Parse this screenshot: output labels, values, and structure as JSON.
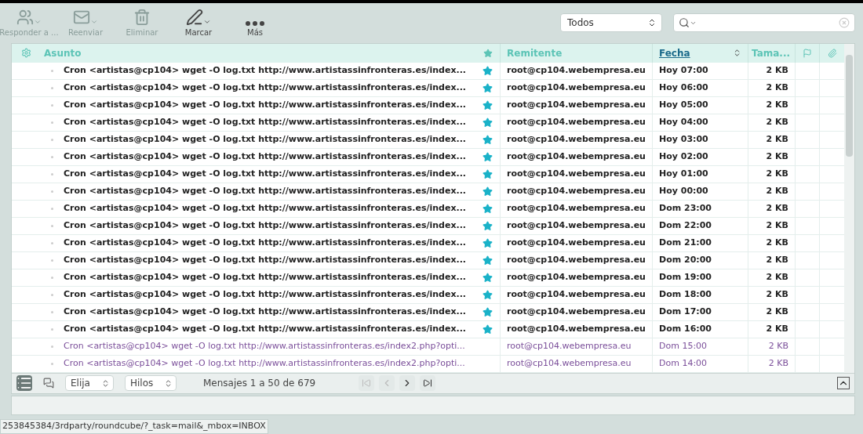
{
  "toolbar": {
    "buttons": [
      {
        "label": "Responder a ...",
        "kind": "reply",
        "disabled": true,
        "menu": true
      },
      {
        "label": "Reenviar",
        "kind": "forward",
        "disabled": true,
        "menu": true
      },
      {
        "label": "Eliminar",
        "kind": "delete",
        "disabled": true,
        "menu": false
      },
      {
        "label": "Marcar",
        "kind": "mark",
        "disabled": false,
        "menu": true
      },
      {
        "label": "Más",
        "kind": "more",
        "disabled": false,
        "menu": false
      }
    ],
    "filter": {
      "value": "Todos"
    }
  },
  "table": {
    "columns": [
      {
        "label": "Asunto",
        "sorted": false
      },
      {
        "label": "Remitente",
        "sorted": false
      },
      {
        "label": "Fecha",
        "sorted": true
      },
      {
        "label": "Tama..."
      }
    ],
    "rows": [
      {
        "subject": "Cron <artistas@cp104> wget -O log.txt http://www.artistassinfronteras.es/index...",
        "sender": "root@cp104.webempresa.eu",
        "date": "Hoy 07:00",
        "size": "2 KB",
        "unread": true,
        "starred": true
      },
      {
        "subject": "Cron <artistas@cp104> wget -O log.txt http://www.artistassinfronteras.es/index...",
        "sender": "root@cp104.webempresa.eu",
        "date": "Hoy 06:00",
        "size": "2 KB",
        "unread": true,
        "starred": true
      },
      {
        "subject": "Cron <artistas@cp104> wget -O log.txt http://www.artistassinfronteras.es/index...",
        "sender": "root@cp104.webempresa.eu",
        "date": "Hoy 05:00",
        "size": "2 KB",
        "unread": true,
        "starred": true
      },
      {
        "subject": "Cron <artistas@cp104> wget -O log.txt http://www.artistassinfronteras.es/index...",
        "sender": "root@cp104.webempresa.eu",
        "date": "Hoy 04:00",
        "size": "2 KB",
        "unread": true,
        "starred": true
      },
      {
        "subject": "Cron <artistas@cp104> wget -O log.txt http://www.artistassinfronteras.es/index...",
        "sender": "root@cp104.webempresa.eu",
        "date": "Hoy 03:00",
        "size": "2 KB",
        "unread": true,
        "starred": true
      },
      {
        "subject": "Cron <artistas@cp104> wget -O log.txt http://www.artistassinfronteras.es/index...",
        "sender": "root@cp104.webempresa.eu",
        "date": "Hoy 02:00",
        "size": "2 KB",
        "unread": true,
        "starred": true
      },
      {
        "subject": "Cron <artistas@cp104> wget -O log.txt http://www.artistassinfronteras.es/index...",
        "sender": "root@cp104.webempresa.eu",
        "date": "Hoy 01:00",
        "size": "2 KB",
        "unread": true,
        "starred": true
      },
      {
        "subject": "Cron <artistas@cp104> wget -O log.txt http://www.artistassinfronteras.es/index...",
        "sender": "root@cp104.webempresa.eu",
        "date": "Hoy 00:00",
        "size": "2 KB",
        "unread": true,
        "starred": true
      },
      {
        "subject": "Cron <artistas@cp104> wget -O log.txt http://www.artistassinfronteras.es/index...",
        "sender": "root@cp104.webempresa.eu",
        "date": "Dom 23:00",
        "size": "2 KB",
        "unread": true,
        "starred": true
      },
      {
        "subject": "Cron <artistas@cp104> wget -O log.txt http://www.artistassinfronteras.es/index...",
        "sender": "root@cp104.webempresa.eu",
        "date": "Dom 22:00",
        "size": "2 KB",
        "unread": true,
        "starred": true
      },
      {
        "subject": "Cron <artistas@cp104> wget -O log.txt http://www.artistassinfronteras.es/index...",
        "sender": "root@cp104.webempresa.eu",
        "date": "Dom 21:00",
        "size": "2 KB",
        "unread": true,
        "starred": true
      },
      {
        "subject": "Cron <artistas@cp104> wget -O log.txt http://www.artistassinfronteras.es/index...",
        "sender": "root@cp104.webempresa.eu",
        "date": "Dom 20:00",
        "size": "2 KB",
        "unread": true,
        "starred": true
      },
      {
        "subject": "Cron <artistas@cp104> wget -O log.txt http://www.artistassinfronteras.es/index...",
        "sender": "root@cp104.webempresa.eu",
        "date": "Dom 19:00",
        "size": "2 KB",
        "unread": true,
        "starred": true
      },
      {
        "subject": "Cron <artistas@cp104> wget -O log.txt http://www.artistassinfronteras.es/index...",
        "sender": "root@cp104.webempresa.eu",
        "date": "Dom 18:00",
        "size": "2 KB",
        "unread": true,
        "starred": true
      },
      {
        "subject": "Cron <artistas@cp104> wget -O log.txt http://www.artistassinfronteras.es/index...",
        "sender": "root@cp104.webempresa.eu",
        "date": "Dom 17:00",
        "size": "2 KB",
        "unread": true,
        "starred": true
      },
      {
        "subject": "Cron <artistas@cp104> wget -O log.txt http://www.artistassinfronteras.es/index...",
        "sender": "root@cp104.webempresa.eu",
        "date": "Dom 16:00",
        "size": "2 KB",
        "unread": true,
        "starred": true
      },
      {
        "subject": "Cron <artistas@cp104> wget -O log.txt http://www.artistassinfronteras.es/index2.php?opti...",
        "sender": "root@cp104.webempresa.eu",
        "date": "Dom 15:00",
        "size": "2 KB",
        "unread": false,
        "starred": false
      },
      {
        "subject": "Cron <artistas@cp104> wget -O log.txt http://www.artistassinfronteras.es/index2.php?opti...",
        "sender": "root@cp104.webempresa.eu",
        "date": "Dom 14:00",
        "size": "2 KB",
        "unread": false,
        "starred": false
      }
    ]
  },
  "footer": {
    "selection": "Elija",
    "threads": "Hilos",
    "count": "Mensajes 1 a 50 de 679"
  },
  "status_bar": {
    "url": "253845384/3rdparty/roundcube/?_task=mail&_mbox=INBOX"
  }
}
